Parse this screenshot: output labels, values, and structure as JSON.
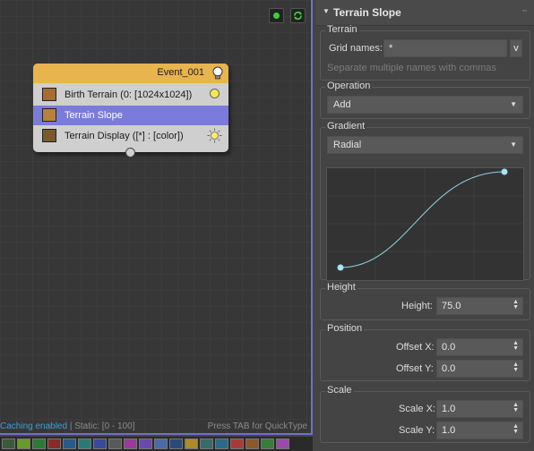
{
  "graph": {
    "event": {
      "title": "Event_001",
      "operators": [
        {
          "label": "Birth Terrain (0: [1024x1024])",
          "icon": "birth-terrain-icon",
          "status": "yellow-dot"
        },
        {
          "label": "Terrain Slope",
          "icon": "terrain-slope-icon",
          "selected": true
        },
        {
          "label": "Terrain Display ([*] : [color])",
          "icon": "terrain-display-icon",
          "status": "bulb"
        }
      ]
    },
    "status": {
      "caching": "Caching enabled",
      "separator": "|",
      "static_range": "Static: [0 - 100]",
      "hint": "Press TAB for QuickType"
    }
  },
  "panel": {
    "title": "Terrain Slope",
    "terrain": {
      "group_label": "Terrain",
      "grid_names_label": "Grid names:",
      "grid_names_value": "*",
      "grid_button": "v",
      "hint": "Separate multiple names with commas"
    },
    "operation": {
      "group_label": "Operation",
      "value": "Add"
    },
    "gradient": {
      "group_label": "Gradient",
      "type": "Radial"
    },
    "height": {
      "group_label": "Height",
      "label": "Height:",
      "value": "75.0"
    },
    "position": {
      "group_label": "Position",
      "offset_x_label": "Offset X:",
      "offset_x": "0.0",
      "offset_y_label": "Offset Y:",
      "offset_y": "0.0"
    },
    "scale": {
      "group_label": "Scale",
      "scale_x_label": "Scale X:",
      "scale_x": "1.0",
      "scale_y_label": "Scale Y:",
      "scale_y": "1.0"
    }
  },
  "colors": {
    "accent": "#6f6fcf",
    "event_header": "#e8b44e",
    "selected_row": "#7b7bdc",
    "status_blue": "#3b9fdc",
    "curve": "#8fd3e8"
  }
}
